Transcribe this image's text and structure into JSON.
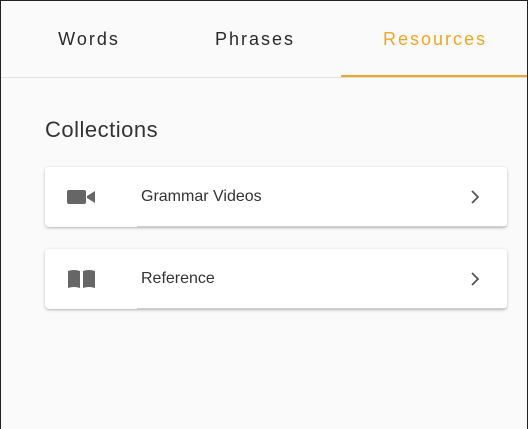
{
  "tabs": [
    {
      "label": "Words",
      "active": false
    },
    {
      "label": "Phrases",
      "active": false
    },
    {
      "label": "Resources",
      "active": true
    }
  ],
  "accent_color": "#f3a51b",
  "section": {
    "title": "Collections"
  },
  "collections": [
    {
      "label": "Grammar Videos",
      "icon": "video-camera-icon"
    },
    {
      "label": "Reference",
      "icon": "book-icon"
    }
  ]
}
